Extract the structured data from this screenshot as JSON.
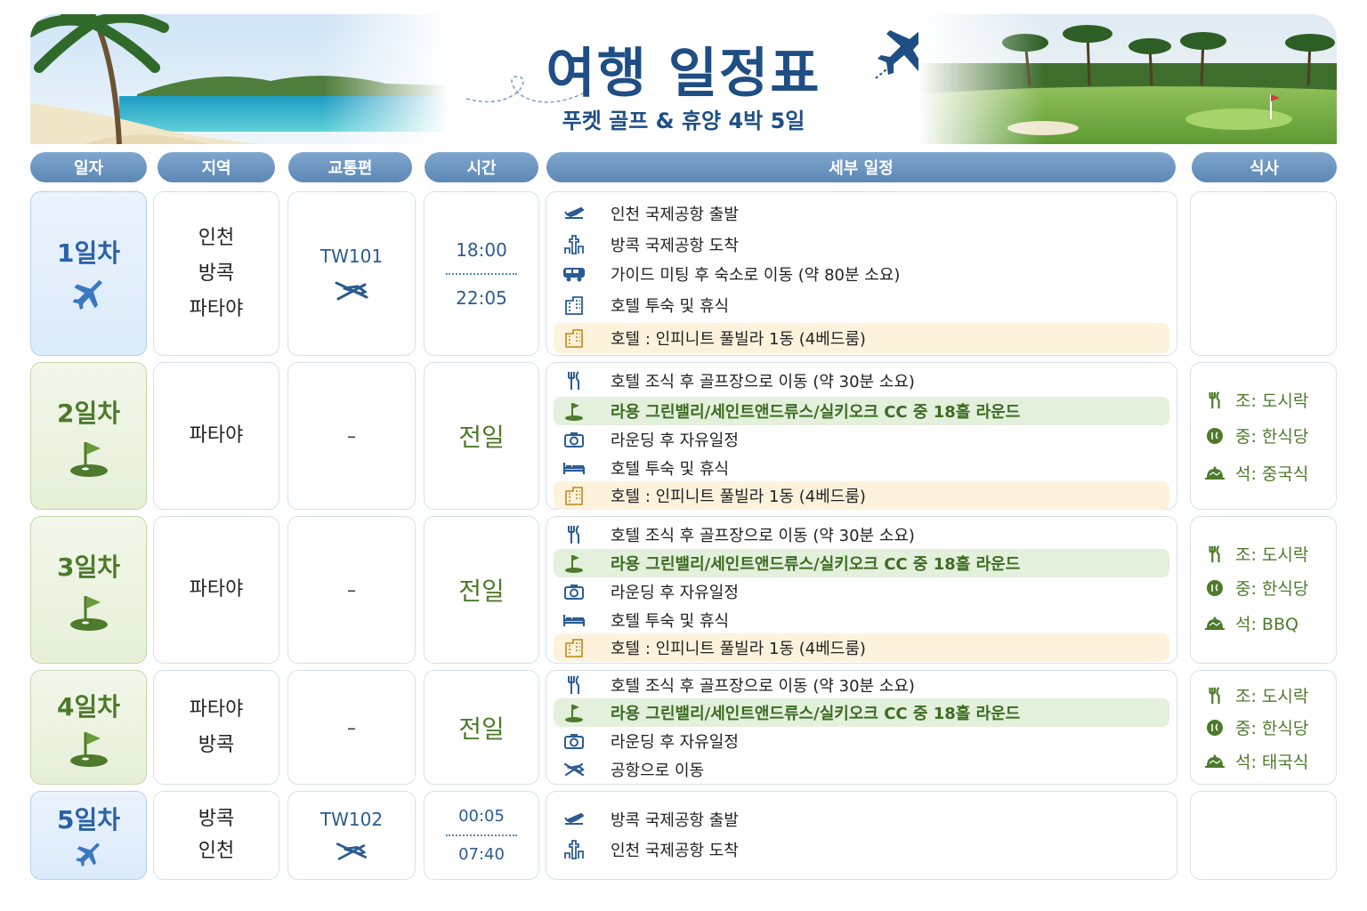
{
  "header": {
    "title": "여행 일정표",
    "subtitle": "푸켓 골프 & 휴양 4박 5일"
  },
  "columns": [
    "일자",
    "지역",
    "교통편",
    "시간",
    "세부 일정",
    "식사"
  ],
  "days": [
    {
      "label": "1일차",
      "regions": [
        "인천",
        "방콕",
        "파타야"
      ],
      "flight": "TW101",
      "time_start": "18:00",
      "time_end": "22:05",
      "items": [
        {
          "icon": "plane-takeoff-icon",
          "text": "인천 국제공항 출발"
        },
        {
          "icon": "airport-tower-icon",
          "text": "방콕 국제공항 도착"
        },
        {
          "icon": "bus-icon",
          "text": "가이드 미팅 후 숙소로 이동 (약 80분 소요)"
        },
        {
          "icon": "hotel-icon",
          "text": "호텔 투숙 및 휴식"
        },
        {
          "icon": "hotel-icon",
          "text": "호텔 : 인피니트 풀빌라 1동 (4베드룸)"
        }
      ]
    },
    {
      "label": "2일차",
      "regions": [
        "파타야"
      ],
      "flight": "–",
      "time_all": "전일",
      "items": [
        {
          "icon": "utensils-icon",
          "text": "호텔 조식 후 골프장으로 이동 (약 30분 소요)"
        },
        {
          "icon": "golf-flag-icon",
          "text": "라용 그린밸리/세인트앤드류스/실키오크 CC 중 18홀 라운드"
        },
        {
          "icon": "camera-icon",
          "text": "라운딩 후 자유일정"
        },
        {
          "icon": "bed-icon",
          "text": "호텔 투숙 및 휴식"
        },
        {
          "icon": "hotel-icon",
          "text": "호텔 : 인피니트 풀빌라 1동 (4베드룸)"
        }
      ],
      "meals": [
        "조: 도시락",
        "중: 한식당",
        "석: 중국식"
      ]
    },
    {
      "label": "3일차",
      "regions": [
        "파타야"
      ],
      "flight": "–",
      "time_all": "전일",
      "items": [
        {
          "icon": "utensils-icon",
          "text": "호텔 조식 후 골프장으로 이동 (약 30분 소요)"
        },
        {
          "icon": "golf-flag-icon",
          "text": "라용 그린밸리/세인트앤드류스/실키오크 CC 중 18홀 라운드"
        },
        {
          "icon": "camera-icon",
          "text": "라운딩 후 자유일정"
        },
        {
          "icon": "bed-icon",
          "text": "호텔 투숙 및 휴식"
        },
        {
          "icon": "hotel-icon",
          "text": "호텔 : 인피니트 풀빌라 1동 (4베드룸)"
        }
      ],
      "meals": [
        "조: 도시락",
        "중: 한식당",
        "석: BBQ"
      ]
    },
    {
      "label": "4일차",
      "regions": [
        "파타야",
        "방콕"
      ],
      "flight": "–",
      "time_all": "전일",
      "items": [
        {
          "icon": "utensils-icon",
          "text": "호텔 조식 후 골프장으로 이동 (약 30분 소요)"
        },
        {
          "icon": "golf-flag-icon",
          "text": "라용 그린밸리/세인트앤드류스/실키오크 CC 중 18홀 라운드"
        },
        {
          "icon": "camera-icon",
          "text": "라운딩 후 자유일정"
        },
        {
          "icon": "plane-icon",
          "text": "공항으로 이동"
        }
      ],
      "meals": [
        "조: 도시락",
        "중: 한식당",
        "석: 태국식"
      ]
    },
    {
      "label": "5일차",
      "regions": [
        "방콕",
        "인천"
      ],
      "flight": "TW102",
      "time_start": "00:05",
      "time_end": "07:40",
      "items": [
        {
          "icon": "plane-takeoff-icon",
          "text": "방콕 국제공항 출발"
        },
        {
          "icon": "airport-tower-icon",
          "text": "인천 국제공항 도착"
        }
      ]
    }
  ],
  "colors": {
    "blue": "#2a62a8",
    "green": "#4d7a2b",
    "header": "#6b94c0"
  }
}
